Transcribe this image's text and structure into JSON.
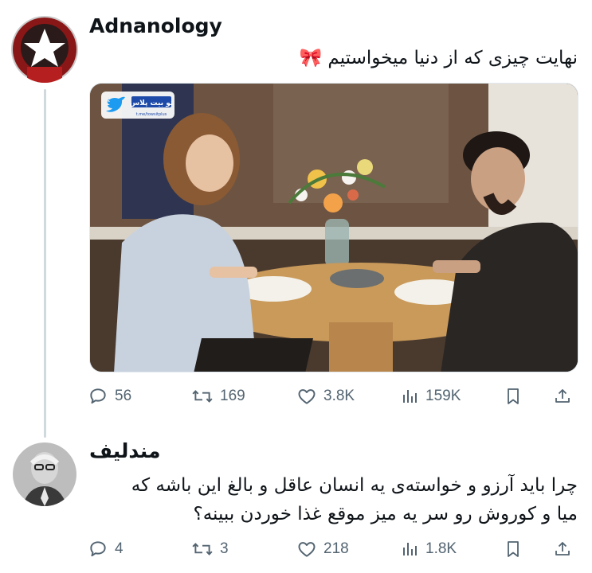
{
  "tweet1": {
    "author": "Adnanology",
    "text": "نهایت چیزی که از دنیا میخواستیم 🎀",
    "media": {
      "watermark": "تو بیت پلاس",
      "watermark_sub": "t.me/towsitplus"
    },
    "stats": {
      "replies": "56",
      "retweets": "169",
      "likes": "3.8K",
      "views": "159K"
    }
  },
  "tweet2": {
    "author": "مندلیف",
    "text_line1": "چرا باید آرزو و خواسته‌ی یه انسان عاقل و بالغ این باشه که",
    "text_line2": "میا و کوروش رو سر یه میز موقع غذا خوردن ببینه؟",
    "stats": {
      "replies": "4",
      "retweets": "3",
      "likes": "218",
      "views": "1.8K"
    }
  },
  "icons": {
    "reply": "speech-bubble-icon",
    "retweet": "retweet-arrows-icon",
    "like": "heart-icon",
    "views": "bar-chart-icon",
    "bookmark": "bookmark-icon",
    "share": "share-upload-icon"
  },
  "colors": {
    "text": "#0f1419",
    "muted": "#536471",
    "thread_line": "#cfd9de",
    "twitter_blue": "#1d9bf0"
  }
}
